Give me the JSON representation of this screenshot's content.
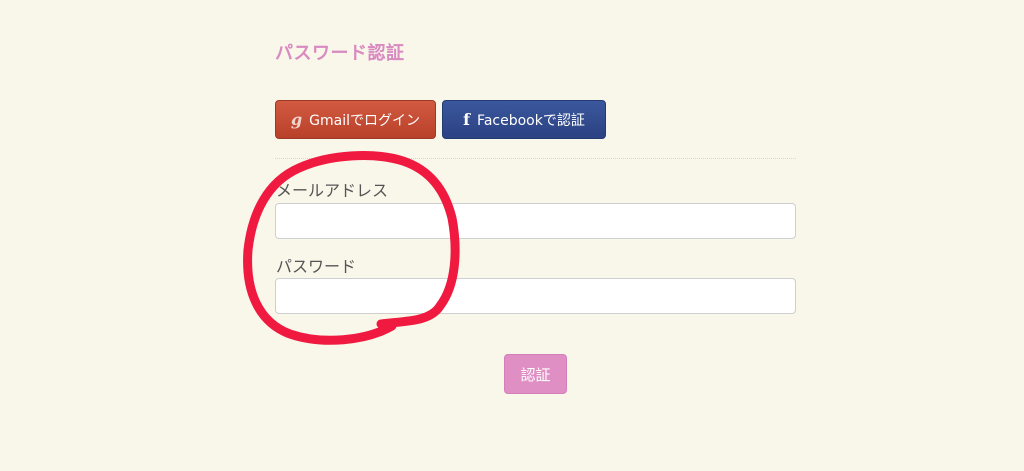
{
  "page": {
    "title": "パスワード認証"
  },
  "social": {
    "gmail_icon": "g",
    "gmail_label": "Gmailでログイン",
    "facebook_icon": "f",
    "facebook_label": "Facebookで認証"
  },
  "form": {
    "email_label": "メールアドレス",
    "email_value": "",
    "password_label": "パスワード",
    "password_value": "",
    "submit_label": "認証"
  },
  "colors": {
    "background": "#f9f6ea",
    "title": "#d98ac0",
    "gmail_button": "#c84f37",
    "facebook_button": "#2f4a8f",
    "submit_button": "#df8fc4",
    "annotation_circle": "#f0193f"
  },
  "icons": {
    "gmail": "gmail-g-icon",
    "facebook": "facebook-f-icon"
  }
}
